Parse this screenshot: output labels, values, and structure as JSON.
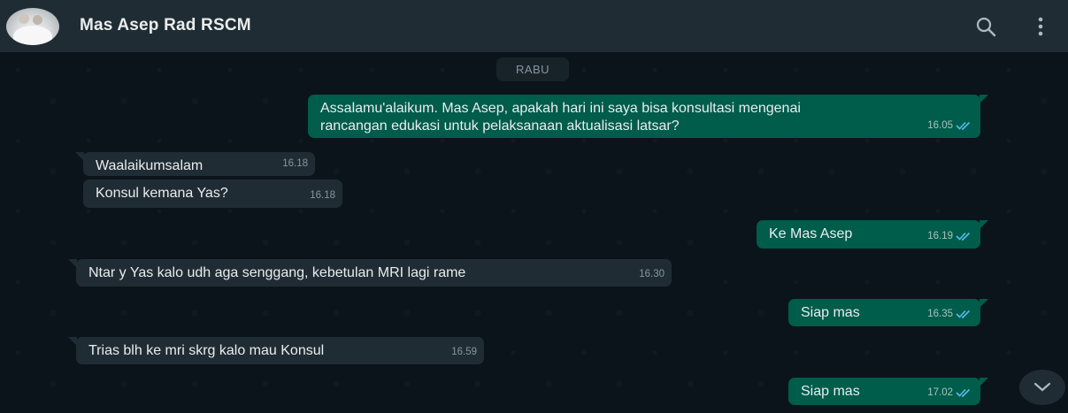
{
  "header": {
    "contact_name": "Mas Asep Rad RSCM",
    "icons": [
      "search-icon",
      "menu-icon"
    ]
  },
  "chat": {
    "day_label": "RABU",
    "messages": [
      {
        "direction": "out",
        "text_line1": "Assalamu'alaikum. Mas Asep, apakah hari ini saya bisa konsultasi mengenai",
        "text_line2": "rancangan edukasi untuk pelaksanaan aktualisasi latsar?",
        "time": "16.05",
        "status": "read"
      },
      {
        "direction": "in",
        "text": "Waalaikumsalam",
        "time": "16.18"
      },
      {
        "direction": "in",
        "text": "Konsul kemana Yas?",
        "time": "16.18"
      },
      {
        "direction": "out",
        "text": "Ke Mas Asep",
        "time": "16.19",
        "status": "read"
      },
      {
        "direction": "in",
        "text": "Ntar y Yas kalo udh aga senggang, kebetulan MRI lagi rame",
        "time": "16.30"
      },
      {
        "direction": "out",
        "text": "Siap mas",
        "time": "16.35",
        "status": "read"
      },
      {
        "direction": "in",
        "text": "Trias blh ke mri skrg kalo mau Konsul",
        "time": "16.59"
      },
      {
        "direction": "out",
        "text": "Siap mas",
        "time": "17.02",
        "status": "read"
      }
    ]
  },
  "colors": {
    "header_bg": "#202c33",
    "chat_bg": "#0b141a",
    "outgoing_bubble": "#005c4b",
    "incoming_bubble": "#202c33",
    "read_tick": "#53bdeb"
  }
}
